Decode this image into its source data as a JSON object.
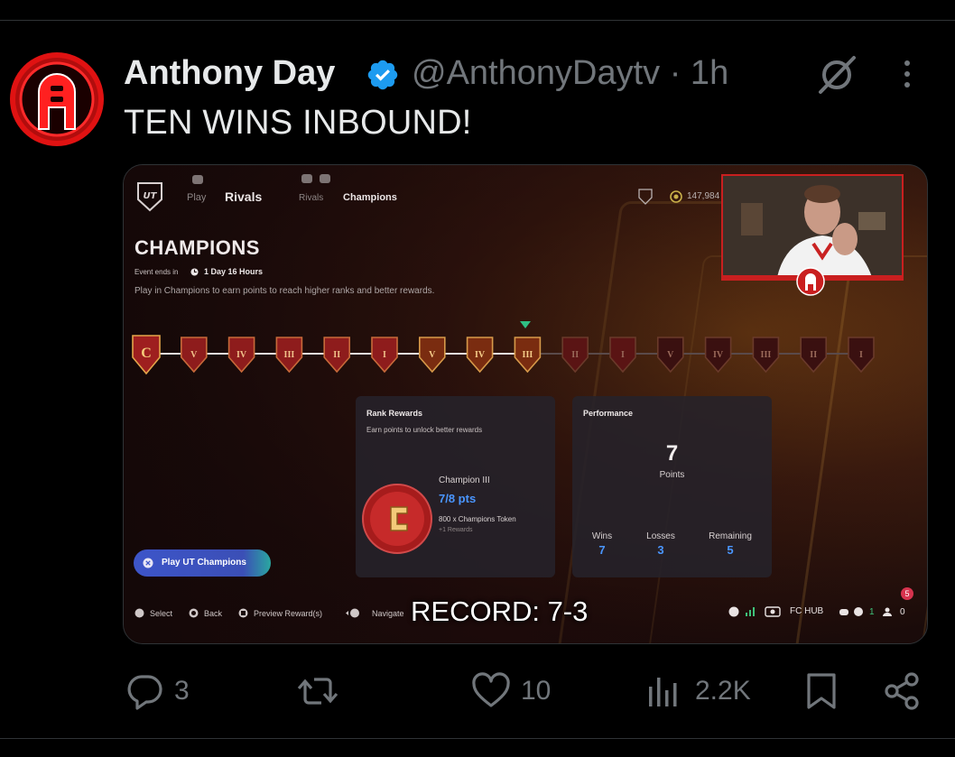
{
  "tweet": {
    "author_name": "Anthony Day",
    "handle": "@AnthonyDaytv",
    "separator_time": "· 1h",
    "text": "TEN WINS INBOUND!"
  },
  "game": {
    "nav": {
      "play": "Play",
      "rivals": "Rivals",
      "rivals_sub": "Rivals",
      "champions": "Champions"
    },
    "coins": "147,984",
    "title": "CHAMPIONS",
    "event_label": "Event ends in",
    "event_time": "1 Day 16 Hours",
    "event_desc": "Play in Champions to earn points to reach higher ranks and better rewards.",
    "ranks": [
      "C",
      "V",
      "IV",
      "III",
      "II",
      "I",
      "V",
      "IV",
      "III",
      "II",
      "I",
      "V",
      "IV",
      "III",
      "II",
      "I"
    ],
    "current_rank_index": 8,
    "rank_rewards": {
      "title": "Rank Rewards",
      "subtitle": "Earn points to unlock better rewards",
      "rank_name": "Champion III",
      "points": "7/8 pts",
      "token": "800 x Champions Token",
      "more": "+1 Rewards"
    },
    "performance": {
      "title": "Performance",
      "points_value": "7",
      "points_label": "Points",
      "wins_label": "Wins",
      "wins": "7",
      "losses_label": "Losses",
      "losses": "3",
      "remaining_label": "Remaining",
      "remaining": "5"
    },
    "play_button": "Play UT Champions",
    "hints": {
      "select": "Select",
      "back": "Back",
      "preview": "Preview Reward(s)",
      "navigate": "Navigate"
    },
    "record_overlay": "RECORD: 7-3",
    "fc_hub": "FC HUB",
    "status_count_a": "1",
    "status_count_b": "0",
    "notification_count": "5"
  },
  "actions": {
    "replies": "3",
    "reposts": "",
    "likes": "10",
    "views": "2.2K"
  },
  "colors": {
    "accent_blue": "#1d9bf0",
    "muted": "#71767b",
    "game_blue": "#4a96ff",
    "rank_red": "#8e1c1c"
  }
}
